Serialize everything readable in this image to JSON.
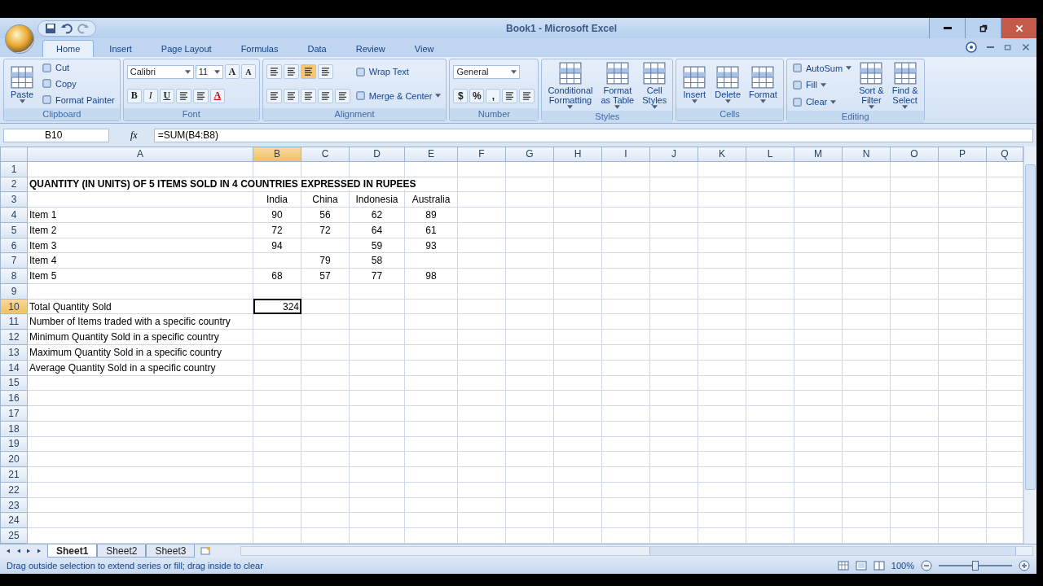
{
  "window": {
    "title": "Book1 - Microsoft Excel"
  },
  "tabs": [
    {
      "label": "Home",
      "selected": true
    },
    {
      "label": "Insert",
      "selected": false
    },
    {
      "label": "Page Layout",
      "selected": false
    },
    {
      "label": "Formulas",
      "selected": false
    },
    {
      "label": "Data",
      "selected": false
    },
    {
      "label": "Review",
      "selected": false
    },
    {
      "label": "View",
      "selected": false
    }
  ],
  "ribbon": [
    {
      "label": "Clipboard",
      "columns": [
        [
          [
            {
              "kind": "large",
              "lines": [
                "Paste"
              ],
              "menu": true
            }
          ]
        ],
        [
          [
            {
              "kind": "small",
              "label": "Cut",
              "menu": false
            }
          ],
          [
            {
              "kind": "small",
              "label": "Copy",
              "menu": false
            }
          ],
          [
            {
              "kind": "small",
              "label": "Format Painter",
              "menu": false
            }
          ]
        ]
      ]
    },
    {
      "label": "Font",
      "columns": [
        [
          [
            {
              "kind": "combo",
              "value": "Calibri",
              "wide": true
            },
            {
              "kind": "combo",
              "value": "11",
              "wide": false
            },
            {
              "kind": "grow",
              "text": "A"
            },
            {
              "kind": "shrink",
              "text": "A"
            }
          ],
          [
            {
              "kind": "bold",
              "text": "B"
            },
            {
              "kind": "italic",
              "text": "I"
            },
            {
              "kind": "underline",
              "text": "U"
            },
            {
              "kind": "icon",
              "pressed": false
            },
            {
              "kind": "icon",
              "pressed": false
            },
            {
              "kind": "fontcolor",
              "text": "A"
            }
          ]
        ]
      ]
    },
    {
      "label": "Alignment",
      "columns": [
        [
          [
            {
              "kind": "icon",
              "pressed": false
            },
            {
              "kind": "icon",
              "pressed": false
            },
            {
              "kind": "icon",
              "pressed": true
            },
            {
              "kind": "icon",
              "pressed": false
            }
          ],
          [
            {
              "kind": "icon",
              "pressed": false
            },
            {
              "kind": "icon",
              "pressed": false
            },
            {
              "kind": "icon",
              "pressed": false
            },
            {
              "kind": "icon",
              "pressed": false
            },
            {
              "kind": "icon",
              "pressed": false
            }
          ]
        ],
        [
          [
            {
              "kind": "small",
              "label": "Wrap Text",
              "menu": false
            }
          ],
          [
            {
              "kind": "small",
              "label": "Merge & Center",
              "menu": true
            }
          ]
        ]
      ]
    },
    {
      "label": "Number",
      "columns": [
        [
          [
            {
              "kind": "combo",
              "value": "General",
              "wide": true
            }
          ],
          [
            {
              "kind": "symbol",
              "text": "$"
            },
            {
              "kind": "symbol",
              "text": "%"
            },
            {
              "kind": "symbol",
              "text": ","
            },
            {
              "kind": "icon",
              "pressed": false
            },
            {
              "kind": "icon",
              "pressed": false
            }
          ]
        ]
      ]
    },
    {
      "label": "Styles",
      "columns": [
        [
          [
            {
              "kind": "large",
              "lines": [
                "Conditional",
                "Formatting"
              ],
              "menu": true
            }
          ]
        ],
        [
          [
            {
              "kind": "large",
              "lines": [
                "Format",
                "as Table"
              ],
              "menu": true
            }
          ]
        ],
        [
          [
            {
              "kind": "large",
              "lines": [
                "Cell",
                "Styles"
              ],
              "menu": true
            }
          ]
        ]
      ]
    },
    {
      "label": "Cells",
      "columns": [
        [
          [
            {
              "kind": "large",
              "lines": [
                "Insert"
              ],
              "menu": true
            }
          ]
        ],
        [
          [
            {
              "kind": "large",
              "lines": [
                "Delete"
              ],
              "menu": true
            }
          ]
        ],
        [
          [
            {
              "kind": "large",
              "lines": [
                "Format"
              ],
              "menu": true
            }
          ]
        ]
      ]
    },
    {
      "label": "Editing",
      "columns": [
        [
          [
            {
              "kind": "small",
              "label": "AutoSum",
              "menu": true
            }
          ],
          [
            {
              "kind": "small",
              "label": "Fill",
              "menu": true
            }
          ],
          [
            {
              "kind": "small",
              "label": "Clear",
              "menu": true
            }
          ]
        ],
        [
          [
            {
              "kind": "large",
              "lines": [
                "Sort &",
                "Filter"
              ],
              "menu": true
            }
          ]
        ],
        [
          [
            {
              "kind": "large",
              "lines": [
                "Find &",
                "Select"
              ],
              "menu": true
            }
          ]
        ]
      ]
    }
  ],
  "formula_bar": {
    "name_box": "B10",
    "fx": "fx",
    "formula": "=SUM(B4:B8)"
  },
  "columns": [
    {
      "label": "A",
      "selected": false
    },
    {
      "label": "B",
      "selected": true
    },
    {
      "label": "C",
      "selected": false
    },
    {
      "label": "D",
      "selected": false
    },
    {
      "label": "E",
      "selected": false
    },
    {
      "label": "F",
      "selected": false
    },
    {
      "label": "G",
      "selected": false
    },
    {
      "label": "H",
      "selected": false
    },
    {
      "label": "I",
      "selected": false
    },
    {
      "label": "J",
      "selected": false
    },
    {
      "label": "K",
      "selected": false
    },
    {
      "label": "L",
      "selected": false
    },
    {
      "label": "M",
      "selected": false
    },
    {
      "label": "N",
      "selected": false
    },
    {
      "label": "O",
      "selected": false
    },
    {
      "label": "P",
      "selected": false
    },
    {
      "label": "Q",
      "selected": false
    }
  ],
  "rows": [
    {
      "label": "1",
      "selected": false
    },
    {
      "label": "2",
      "selected": false,
      "cells": {
        "A": {
          "kind": "title",
          "text": "QUANTITY (IN UNITS) OF 5 ITEMS SOLD IN 4 COUNTRIES EXPRESSED IN RUPEES",
          "selected": false
        }
      }
    },
    {
      "label": "3",
      "selected": false,
      "cells": {
        "B": {
          "kind": "number",
          "text": "India",
          "selected": false
        },
        "C": {
          "kind": "number",
          "text": "China",
          "selected": false
        },
        "D": {
          "kind": "number",
          "text": "Indonesia",
          "selected": false
        },
        "E": {
          "kind": "number",
          "text": "Australia",
          "selected": false
        }
      }
    },
    {
      "label": "4",
      "selected": false,
      "cells": {
        "A": {
          "kind": "label",
          "text": "Item 1",
          "selected": false
        },
        "B": {
          "kind": "number",
          "text": "90",
          "selected": false
        },
        "C": {
          "kind": "number",
          "text": "56",
          "selected": false
        },
        "D": {
          "kind": "number",
          "text": "62",
          "selected": false
        },
        "E": {
          "kind": "number",
          "text": "89",
          "selected": false
        }
      }
    },
    {
      "label": "5",
      "selected": false,
      "cells": {
        "A": {
          "kind": "label",
          "text": "Item 2",
          "selected": false
        },
        "B": {
          "kind": "number",
          "text": "72",
          "selected": false
        },
        "C": {
          "kind": "number",
          "text": "72",
          "selected": false
        },
        "D": {
          "kind": "number",
          "text": "64",
          "selected": false
        },
        "E": {
          "kind": "number",
          "text": "61",
          "selected": false
        }
      }
    },
    {
      "label": "6",
      "selected": false,
      "cells": {
        "A": {
          "kind": "label",
          "text": "Item 3",
          "selected": false
        },
        "B": {
          "kind": "number",
          "text": "94",
          "selected": false
        },
        "D": {
          "kind": "number",
          "text": "59",
          "selected": false
        },
        "E": {
          "kind": "number",
          "text": "93",
          "selected": false
        }
      }
    },
    {
      "label": "7",
      "selected": false,
      "cells": {
        "A": {
          "kind": "label",
          "text": "Item 4",
          "selected": false
        },
        "C": {
          "kind": "number",
          "text": "79",
          "selected": false
        },
        "D": {
          "kind": "number",
          "text": "58",
          "selected": false
        }
      }
    },
    {
      "label": "8",
      "selected": false,
      "cells": {
        "A": {
          "kind": "label",
          "text": "Item 5",
          "selected": false
        },
        "B": {
          "kind": "number",
          "text": "68",
          "selected": false
        },
        "C": {
          "kind": "number",
          "text": "57",
          "selected": false
        },
        "D": {
          "kind": "number",
          "text": "77",
          "selected": false
        },
        "E": {
          "kind": "number",
          "text": "98",
          "selected": false
        }
      }
    },
    {
      "label": "9",
      "selected": false
    },
    {
      "label": "10",
      "selected": true,
      "cells": {
        "A": {
          "kind": "label",
          "text": "Total Quantity Sold",
          "selected": false
        },
        "B": {
          "kind": "total",
          "text": "324",
          "selected": true
        }
      }
    },
    {
      "label": "11",
      "selected": false,
      "cells": {
        "A": {
          "kind": "label",
          "text": "Number of Items traded with a specific country",
          "selected": false
        }
      }
    },
    {
      "label": "12",
      "selected": false,
      "cells": {
        "A": {
          "kind": "label",
          "text": "Minimum Quantity Sold in a specific country",
          "selected": false
        }
      }
    },
    {
      "label": "13",
      "selected": false,
      "cells": {
        "A": {
          "kind": "label",
          "text": "Maximum Quantity Sold in a specific country",
          "selected": false
        }
      }
    },
    {
      "label": "14",
      "selected": false,
      "cells": {
        "A": {
          "kind": "label",
          "text": "Average Quantity Sold in a specific country",
          "selected": false
        }
      }
    },
    {
      "label": "15",
      "selected": false
    },
    {
      "label": "16",
      "selected": false
    },
    {
      "label": "17",
      "selected": false
    },
    {
      "label": "18",
      "selected": false
    },
    {
      "label": "19",
      "selected": false
    },
    {
      "label": "20",
      "selected": false
    },
    {
      "label": "21",
      "selected": false
    },
    {
      "label": "22",
      "selected": false
    },
    {
      "label": "23",
      "selected": false
    },
    {
      "label": "24",
      "selected": false
    },
    {
      "label": "25",
      "selected": false
    }
  ],
  "sheet_tabs": [
    {
      "label": "Sheet1",
      "selected": true
    },
    {
      "label": "Sheet2",
      "selected": false
    },
    {
      "label": "Sheet3",
      "selected": false
    }
  ],
  "status_bar": {
    "message": "Drag outside selection to extend series or fill; drag inside to clear",
    "zoom": "100%",
    "zoom_slider": {
      "level": 0.5
    }
  }
}
